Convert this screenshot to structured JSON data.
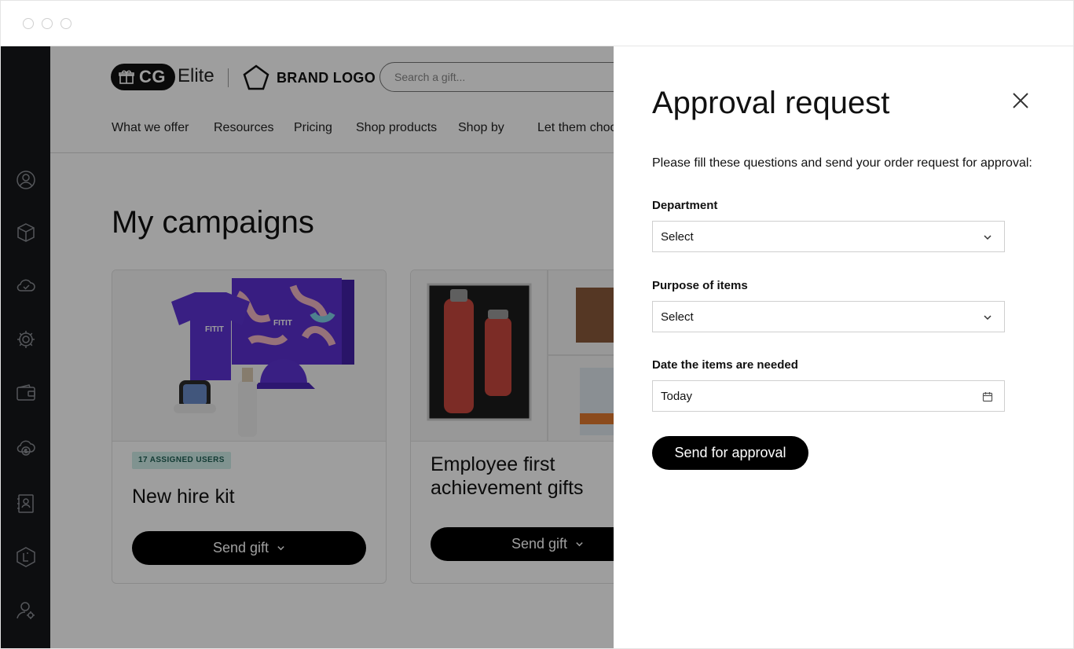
{
  "header": {
    "logo_cg": "CG",
    "logo_elite": "Elite",
    "brand_logo": "BRAND LOGO",
    "search_placeholder": "Search a gift..."
  },
  "nav": {
    "items": [
      "What we offer",
      "Resources",
      "Pricing",
      "Shop products",
      "Shop by",
      "Let them choo"
    ]
  },
  "main": {
    "title": "My campaigns",
    "cards": [
      {
        "badge": "17 ASSIGNED USERS",
        "title": "New hire kit",
        "button": "Send gift",
        "product_brand": "FITIT"
      },
      {
        "badge": "",
        "title_line1": "Employee first",
        "title_line2": "achievement gifts",
        "button": "Send gift"
      }
    ]
  },
  "panel": {
    "title": "Approval request",
    "intro": "Please fill these questions and send your order request for approval:",
    "fields": [
      {
        "label": "Department",
        "value": "Select",
        "type": "select"
      },
      {
        "label": "Purpose of items",
        "value": "Select",
        "type": "select"
      },
      {
        "label": "Date the items are needed",
        "value": "Today",
        "type": "date"
      }
    ],
    "submit": "Send for approval"
  },
  "sidebar": {
    "icons": [
      "user-circle-icon",
      "box-icon",
      "cloud-check-icon",
      "gear-icon",
      "wallet-icon",
      "cloud-dollar-icon",
      "contacts-book-icon",
      "hexagon-logo-icon",
      "person-settings-icon"
    ]
  },
  "colors": {
    "sidebar_bg": "#16171a",
    "badge_bg": "#cfeee8",
    "accent_purple": "#5b2fd1",
    "bottle_red": "#c8473e"
  }
}
